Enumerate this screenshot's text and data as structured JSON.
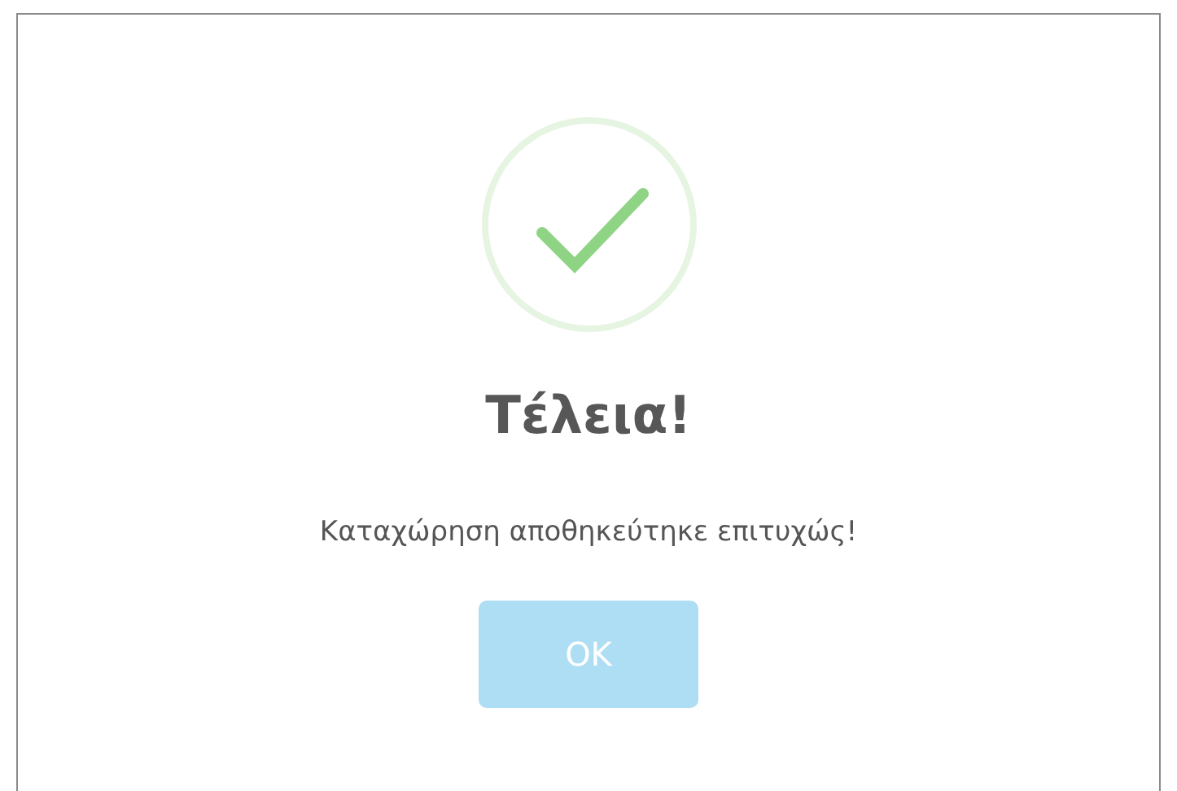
{
  "dialog": {
    "title": "Τέλεια!",
    "message": "Καταχώρηση αποθηκεύτηκε επιτυχώς!",
    "buttons": [
      {
        "label": "OK"
      }
    ]
  }
}
